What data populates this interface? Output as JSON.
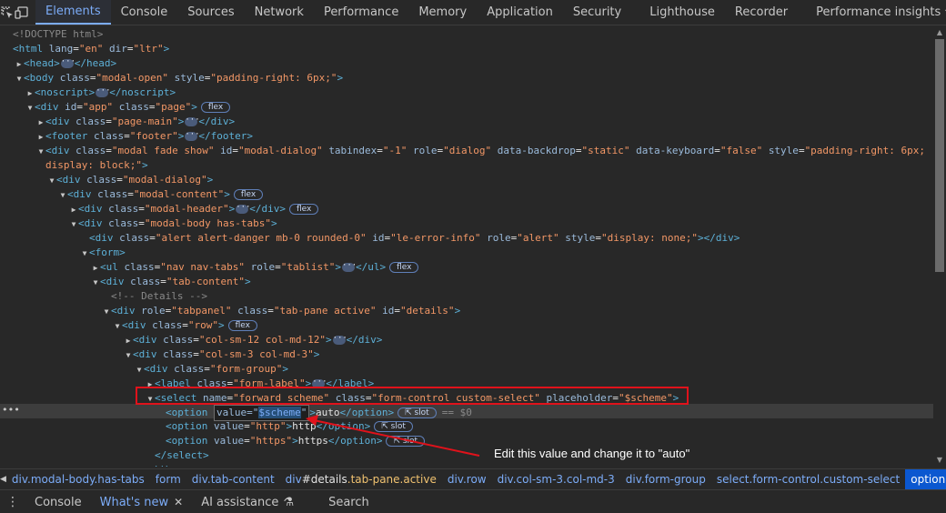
{
  "tabs": [
    {
      "label": "Elements",
      "active": true
    },
    {
      "label": "Console"
    },
    {
      "label": "Sources"
    },
    {
      "label": "Network"
    },
    {
      "label": "Performance"
    },
    {
      "label": "Memory"
    },
    {
      "label": "Application"
    },
    {
      "label": "Security"
    },
    {
      "label": "Lighthouse"
    },
    {
      "label": "Recorder"
    },
    {
      "label": "Performance insights"
    }
  ],
  "code": {
    "l0": "<!DOCTYPE html>",
    "l1_tag": "<html",
    "l1_a1": "lang",
    "l1_v1": "\"en\"",
    "l1_a2": "dir",
    "l1_v2": "\"ltr\"",
    "l2_open": "<head>",
    "l2_close": "</head>",
    "l3_open": "<body",
    "l3_a1": "class",
    "l3_v1": "\"modal-open\"",
    "l3_a2": "style",
    "l3_v2": "\"padding-right: 6px;\"",
    "l4_open": "<noscript>",
    "l4_close": "</noscript>",
    "l5_a1": "id",
    "l5_v1": "\"app\"",
    "l5_a2": "class",
    "l5_v2": "\"page\"",
    "l6_v": "\"page-main\"",
    "l7_v": "\"footer\"",
    "l8_v1": "\"modal fade show\"",
    "l8_v2": "\"modal-dialog\"",
    "l8_a3": "tabindex",
    "l8_v3": "\"-1\"",
    "l8_a4": "role",
    "l8_v4": "\"dialog\"",
    "l8_a5": "data-backdrop",
    "l8_v5": "\"static\"",
    "l8_a6": "data-keyboard",
    "l8_v6": "\"false\"",
    "l8_v7a": "\"padding-right: 6px;",
    "l8_v7b": "display: block;\"",
    "l9_v": "\"modal-dialog\"",
    "l10_v": "\"modal-content\"",
    "l11_v": "\"modal-header\"",
    "l12_v": "\"modal-body has-tabs\"",
    "l13_v1": "\"alert alert-danger mb-0 rounded-0\"",
    "l13_v2": "\"le-error-info\"",
    "l13_v3": "\"alert\"",
    "l13_v4": "\"display: none;\"",
    "l14": "<form>",
    "l15_v1": "\"nav nav-tabs\"",
    "l15_a2": "role",
    "l15_v2": "\"tablist\"",
    "l16_v": "\"tab-content\"",
    "l17": "<!-- Details -->",
    "l18_v1": "\"tabpanel\"",
    "l18_v2": "\"tab-pane active\"",
    "l18_v3": "\"details\"",
    "l19_v": "\"row\"",
    "l20_v": "\"col-sm-12 col-md-12\"",
    "l21_v": "\"col-sm-3 col-md-3\"",
    "l22_v": "\"form-group\"",
    "l23_v": "\"form-label\"",
    "l24_a1": "name",
    "l24_v1": "\"forward_scheme\"",
    "l24_v2": "\"form-control custom-select\"",
    "l24_a3": "placeholder",
    "l24_v3": "\"$scheme\"",
    "opt_tag": "<option",
    "opt_attr": "value",
    "opt1_quote_open": "=\"",
    "opt1_value": "$scheme",
    "opt1_quote_close": "\"",
    "opt1_text": "auto",
    "opt2_v": "\"http\"",
    "opt2_text": "http",
    "opt3_v": "\"https\"",
    "opt3_text": "https",
    "close_option": "</option>",
    "close_select": "</select>",
    "close_div": "</div>",
    "dollar0": "== $0",
    "badge_flex": "flex",
    "badge_slot": "slot"
  },
  "annotation": "Edit this value and change it to \"auto\"",
  "breadcrumbs": [
    {
      "tag": "div",
      "cls": ".modal-body.has-tabs"
    },
    {
      "tag": "form",
      "cls": ""
    },
    {
      "tag": "div",
      "cls": ".tab-content"
    },
    {
      "tag": "div",
      "id": "#details",
      "cls": ".tab-pane.active"
    },
    {
      "tag": "div",
      "cls": ".row"
    },
    {
      "tag": "div",
      "cls": ".col-sm-3.col-md-3"
    },
    {
      "tag": "div",
      "cls": ".form-group"
    },
    {
      "tag": "select",
      "cls": ".form-control.custom-select"
    },
    {
      "tag": "option",
      "cls": "",
      "active": true
    }
  ],
  "drawer": [
    {
      "label": "Console"
    },
    {
      "label": "What's new",
      "active": true,
      "closable": true
    },
    {
      "label": "AI assistance"
    },
    {
      "label": "Search"
    }
  ],
  "colors": {
    "accent": "#7cacf8",
    "highlight_box": "#e0121b",
    "arrow": "#e0121b"
  }
}
